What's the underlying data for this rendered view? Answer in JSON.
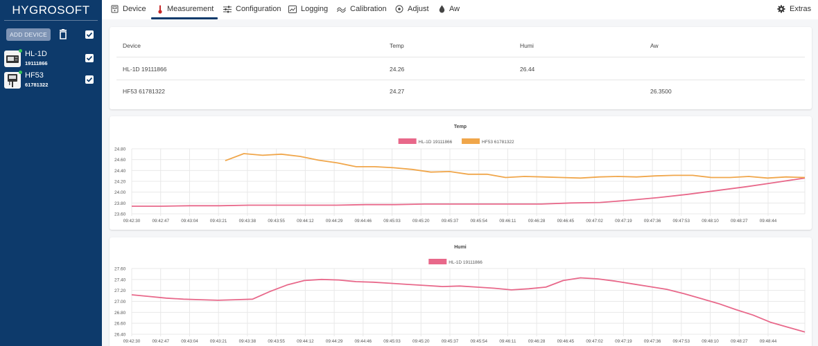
{
  "sidebar": {
    "brand": "HYGROSOFT",
    "add_device_label": "ADD DEVICE",
    "devices": [
      {
        "name": "HL-1D",
        "serial": "19111866"
      },
      {
        "name": "HF53",
        "serial": "61781322"
      }
    ]
  },
  "nav": {
    "tabs": [
      {
        "label": "Device",
        "icon": "device-icon"
      },
      {
        "label": "Measurement",
        "icon": "thermometer-icon"
      },
      {
        "label": "Configuration",
        "icon": "sliders-icon"
      },
      {
        "label": "Logging",
        "icon": "logging-icon"
      },
      {
        "label": "Calibration",
        "icon": "calibration-icon"
      },
      {
        "label": "Adjust",
        "icon": "target-icon"
      },
      {
        "label": "Aw",
        "icon": "drop-icon"
      }
    ],
    "active_tab": "Measurement",
    "extras_label": "Extras",
    "accent_color": "#0d3a6b"
  },
  "table": {
    "headers": [
      "Device",
      "Temp",
      "Humi",
      "Aw"
    ],
    "rows": [
      [
        "HL-1D 19111866",
        "24.26",
        "26.44",
        ""
      ],
      [
        "HF53 61781322",
        "24.27",
        "",
        "26.3500"
      ]
    ]
  },
  "chart_data": [
    {
      "type": "line",
      "title": "Temp",
      "x": [
        "09:42:30",
        "09:42:47",
        "09:43:04",
        "09:43:21",
        "09:43:38",
        "09:43:55",
        "09:44:12",
        "09:44:29",
        "09:44:46",
        "09:45:03",
        "09:45:20",
        "09:45:37",
        "09:45:54",
        "09:46:11",
        "09:46:28",
        "09:46:45",
        "09:47:02",
        "09:47:19",
        "09:47:36",
        "09:47:53",
        "09:48:10",
        "09:48:27",
        "09:48:44"
      ],
      "ylim": [
        23.6,
        24.8
      ],
      "yticks": [
        "24.80",
        "24.60",
        "24.40",
        "24.20",
        "24.00",
        "23.80",
        "23.60"
      ],
      "grid": true,
      "legend": "top-center",
      "series": [
        {
          "name": "HL-1D 19111866",
          "color": "#e8688a",
          "values": [
            23.74,
            23.74,
            23.75,
            23.75,
            23.76,
            23.76,
            23.76,
            23.76,
            23.77,
            23.77,
            23.78,
            23.78,
            23.78,
            23.78,
            23.78,
            23.8,
            23.81,
            23.85,
            23.9,
            23.96,
            24.03,
            24.1,
            24.18,
            24.26
          ]
        },
        {
          "name": "HF53 61781322",
          "color": "#f0a64a",
          "values": [
            null,
            null,
            null,
            null,
            null,
            24.58,
            24.71,
            24.68,
            24.7,
            24.66,
            24.59,
            24.54,
            24.47,
            24.47,
            24.45,
            24.42,
            24.37,
            24.38,
            24.33,
            24.33,
            24.27,
            24.29,
            24.28,
            24.27,
            24.26,
            24.28,
            24.29,
            24.28,
            24.3,
            24.31,
            24.31,
            24.27,
            24.27,
            24.29,
            24.26,
            24.28,
            24.27
          ]
        }
      ]
    },
    {
      "type": "line",
      "title": "Humi",
      "x": [
        "09:42:30",
        "09:42:47",
        "09:43:04",
        "09:43:21",
        "09:43:38",
        "09:43:55",
        "09:44:12",
        "09:44:29",
        "09:44:46",
        "09:45:03",
        "09:45:20",
        "09:45:37",
        "09:45:54",
        "09:46:11",
        "09:46:28",
        "09:46:45",
        "09:47:02",
        "09:47:19",
        "09:47:36",
        "09:47:53",
        "09:48:10",
        "09:48:27",
        "09:48:44"
      ],
      "ylim": [
        26.4,
        27.6
      ],
      "yticks": [
        "27.60",
        "27.40",
        "27.20",
        "27.00",
        "26.80",
        "26.60",
        "26.40"
      ],
      "grid": true,
      "legend": "top-center",
      "series": [
        {
          "name": "HL-1D 19111866",
          "color": "#e8688a",
          "values": [
            27.12,
            27.09,
            27.06,
            27.04,
            27.03,
            27.02,
            27.03,
            27.04,
            27.18,
            27.3,
            27.38,
            27.4,
            27.39,
            27.36,
            27.35,
            27.33,
            27.31,
            27.29,
            27.27,
            27.28,
            27.26,
            27.24,
            27.21,
            27.23,
            27.26,
            27.38,
            27.43,
            27.41,
            27.37,
            27.32,
            27.27,
            27.22,
            27.14,
            27.05,
            26.96,
            26.85,
            26.75,
            26.62,
            26.53,
            26.44
          ]
        }
      ]
    }
  ]
}
